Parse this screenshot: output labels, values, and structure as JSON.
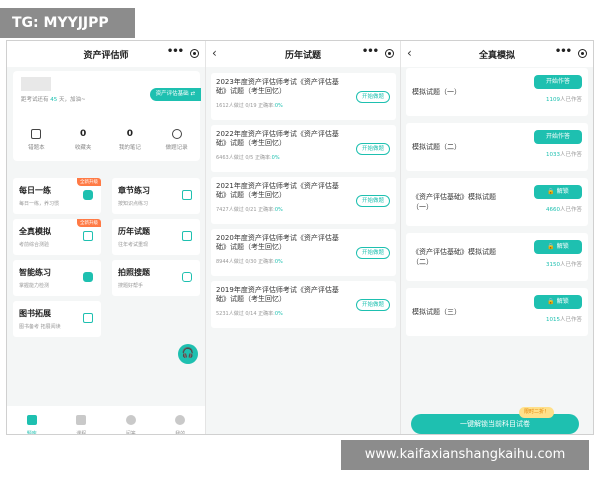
{
  "watermark_top": "TG: MYYJJPP",
  "watermark_bottom": "www.kaifaxianshangkaihu.com",
  "screen1": {
    "title": "资产评估师",
    "exam_prefix": "距考试还有",
    "exam_days": "45",
    "exam_suffix": "天，加油~",
    "subject_button": "资产评估基础 ⇄",
    "stats": [
      {
        "value": "",
        "label": "错题本",
        "icon": "error-book-icon"
      },
      {
        "value": "0",
        "label": "收藏夹",
        "icon": ""
      },
      {
        "value": "0",
        "label": "我的笔记",
        "icon": ""
      },
      {
        "value": "",
        "label": "做题记录",
        "icon": "history-icon"
      }
    ],
    "tiles": [
      {
        "title": "每日一练",
        "sub": "每日一练，养习惯",
        "badge": "全新升级",
        "icon": "daily-practice-icon"
      },
      {
        "title": "章节练习",
        "sub": "按知识点练习",
        "badge": "",
        "icon": "chapter-icon"
      },
      {
        "title": "全真模拟",
        "sub": "考前综合测验",
        "badge": "全新升级",
        "icon": "mock-exam-icon"
      },
      {
        "title": "历年试题",
        "sub": "往年考试重现",
        "badge": "",
        "icon": "calendar-icon"
      },
      {
        "title": "智能练习",
        "sub": "掌握能力检测",
        "badge": "",
        "icon": "smart-practice-icon"
      },
      {
        "title": "拍照搜题",
        "sub": "搜题好帮手",
        "badge": "",
        "icon": "camera-icon"
      },
      {
        "title": "图书拓展",
        "sub": "图书备考 拓展阅读",
        "badge": "",
        "icon": "book-icon"
      }
    ],
    "tabs": [
      {
        "label": "题库",
        "active": true
      },
      {
        "label": "课程",
        "active": false
      },
      {
        "label": "问答",
        "active": false
      },
      {
        "label": "我的",
        "active": false
      }
    ]
  },
  "screen2": {
    "title": "历年试题",
    "papers": [
      {
        "title": "2023年度资产评估师考试《资产评估基础》试题（考生回忆）",
        "meta": "1612人做过 0/19  正确率:",
        "rate": "0%",
        "button": "开始做题"
      },
      {
        "title": "2022年度资产评估师考试《资产评估基础》试题（考生回忆）",
        "meta": "6463人做过 0/5  正确率:",
        "rate": "0%",
        "button": "开始做题"
      },
      {
        "title": "2021年度资产评估师考试《资产评估基础》试题（考生回忆）",
        "meta": "7427人做过 0/21  正确率:",
        "rate": "0%",
        "button": "开始做题"
      },
      {
        "title": "2020年度资产评估师考试《资产评估基础》试题（考生回忆）",
        "meta": "8944人做过 0/30  正确率:",
        "rate": "0%",
        "button": "开始做题"
      },
      {
        "title": "2019年度资产评估师考试《资产评估基础》试题（考生回忆）",
        "meta": "5231人做过 0/14  正确率:",
        "rate": "0%",
        "button": "开始做题"
      }
    ]
  },
  "screen3": {
    "title": "全真模拟",
    "mocks": [
      {
        "title": "模拟试题（一）",
        "button": "开始作答",
        "locked": false,
        "count": "1109",
        "count_suffix": "人已作答"
      },
      {
        "title": "模拟试题（二）",
        "button": "开始作答",
        "locked": false,
        "count": "1033",
        "count_suffix": "人已作答"
      },
      {
        "title": "《资产评估基础》模拟试题（一）",
        "button": "解锁",
        "locked": true,
        "count": "4660",
        "count_suffix": "人已作答"
      },
      {
        "title": "《资产评估基础》模拟试题（二）",
        "button": "解锁",
        "locked": true,
        "count": "3150",
        "count_suffix": "人已作答"
      },
      {
        "title": "模拟试题（三）",
        "button": "解锁",
        "locked": true,
        "count": "1015",
        "count_suffix": "人已作答"
      }
    ],
    "tip": "限时二折！",
    "unlock_all": "一键解锁当前科目试卷"
  },
  "colors": {
    "accent": "#1ec0b0",
    "badge": "#ff7a45",
    "background": "#f4f6f6"
  }
}
